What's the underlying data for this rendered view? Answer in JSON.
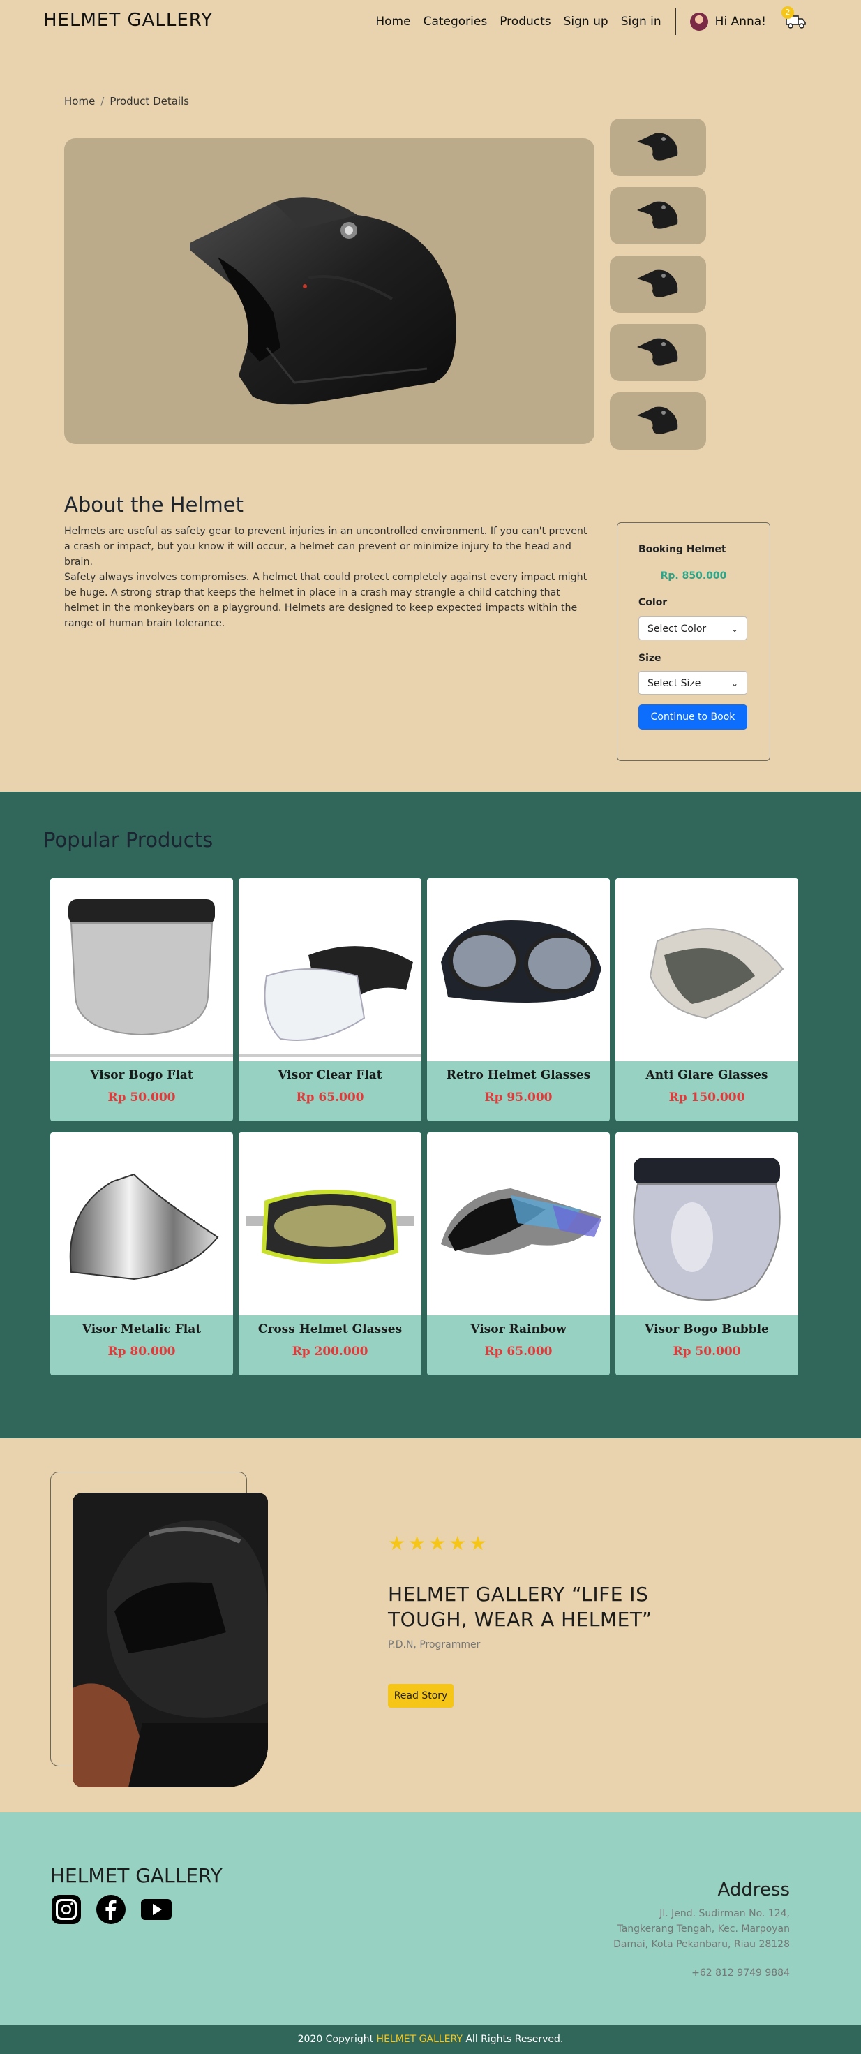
{
  "nav": {
    "brand": "HELMET GALLERY",
    "links": [
      "Home",
      "Categories",
      "Products",
      "Sign up",
      "Sign in"
    ],
    "greeting": "Hi Anna!",
    "cart_count": "2"
  },
  "breadcrumb": {
    "home": "Home",
    "current": "Product Details"
  },
  "about": {
    "title": "About the Helmet",
    "p1": "Helmets are useful as safety gear to prevent injuries in an uncontrolled environment. If you can't prevent a crash or impact, but you know it will occur, a helmet can prevent or minimize injury to the head and brain.",
    "p2": "Safety always involves compromises. A helmet that could protect completely against every impact might be huge. A strong strap that keeps the helmet in place in a crash may strangle a child catching that helmet in the monkeybars on a playground. Helmets are designed to keep expected impacts within the range of human brain tolerance."
  },
  "booking": {
    "title": "Booking Helmet",
    "price": "Rp. 850.000",
    "color_label": "Color",
    "color_value": "Select Color",
    "size_label": "Size",
    "size_value": "Select Size",
    "button": "Continue to Book"
  },
  "popular": {
    "title": "Popular Products",
    "products": [
      {
        "name": "Visor Bogo Flat",
        "price": "Rp 50.000"
      },
      {
        "name": "Visor Clear Flat",
        "price": "Rp 65.000"
      },
      {
        "name": "Retro Helmet Glasses",
        "price": "Rp 95.000"
      },
      {
        "name": "Anti Glare Glasses",
        "price": "Rp 150.000"
      },
      {
        "name": "Visor Metalic Flat",
        "price": "Rp 80.000"
      },
      {
        "name": "Cross Helmet Glasses",
        "price": "Rp 200.000"
      },
      {
        "name": "Visor Rainbow",
        "price": "Rp 65.000"
      },
      {
        "name": "Visor Bogo Bubble",
        "price": "Rp 50.000"
      }
    ]
  },
  "testimonial": {
    "stars": "★★★★★",
    "quote": "HELMET GALLERY “LIFE IS TOUGH, WEAR A HELMET”",
    "author": "P.D.N, Programmer",
    "button": "Read Story"
  },
  "footer": {
    "brand": "HELMET GALLERY",
    "address_title": "Address",
    "address_line1": "Jl. Jend. Sudirman No. 124,",
    "address_line2": "Tangkerang Tengah, Kec. Marpoyan",
    "address_line3": "Damai, Kota Pekanbaru, Riau 28128",
    "phone": "+62 812 9749 9884",
    "copyright_pre": "2020 Copyright",
    "copyright_brand": "HELMET GALLERY",
    "copyright_post": "All Rights Reserved."
  },
  "colors": {
    "background": "#e8d3ae",
    "section_dark": "#30675a",
    "card_mint": "#96d1c1",
    "price_red": "#e03a3a",
    "accent_yellow": "#f5c518",
    "primary_blue": "#0d6efd"
  }
}
